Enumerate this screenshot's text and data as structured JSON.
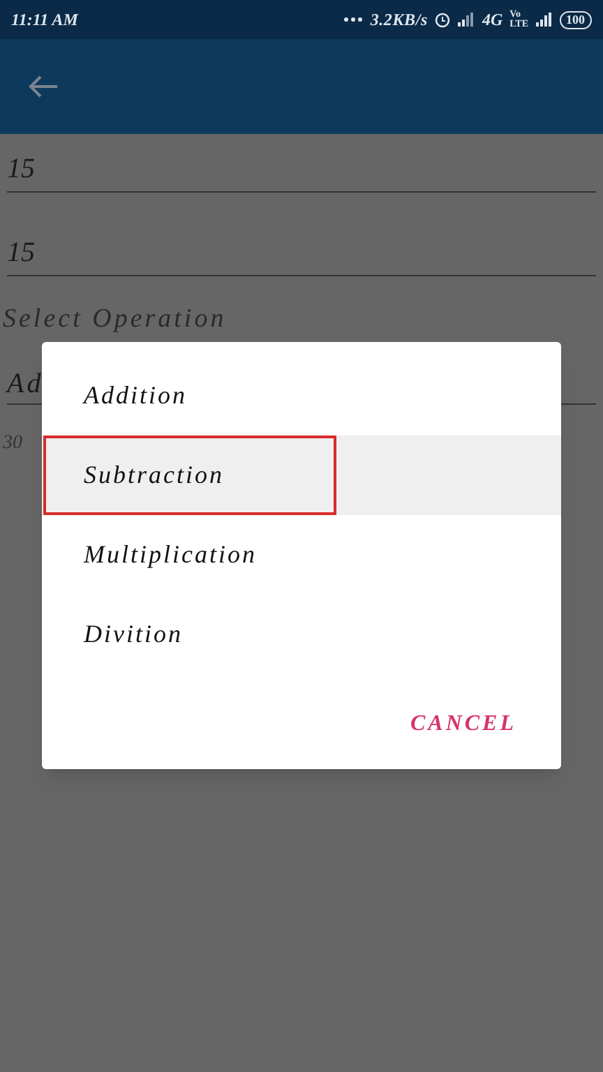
{
  "status_bar": {
    "time": "11:11 AM",
    "speed": "3.2KB/s",
    "network": "4G",
    "volte_top": "Vo",
    "volte_bottom": "LTE",
    "battery": "100"
  },
  "form": {
    "fields": [
      {
        "value": "15"
      },
      {
        "value": "15"
      }
    ],
    "operation_label": "Select Operation",
    "operation_value": "Ad",
    "result": "30"
  },
  "dialog": {
    "options": [
      {
        "label": "Addition",
        "selected": false
      },
      {
        "label": "Subtraction",
        "selected": true
      },
      {
        "label": "Multiplication",
        "selected": false
      },
      {
        "label": "Divition",
        "selected": false
      }
    ],
    "cancel": "CANCEL",
    "annotation_on_selected": true
  }
}
